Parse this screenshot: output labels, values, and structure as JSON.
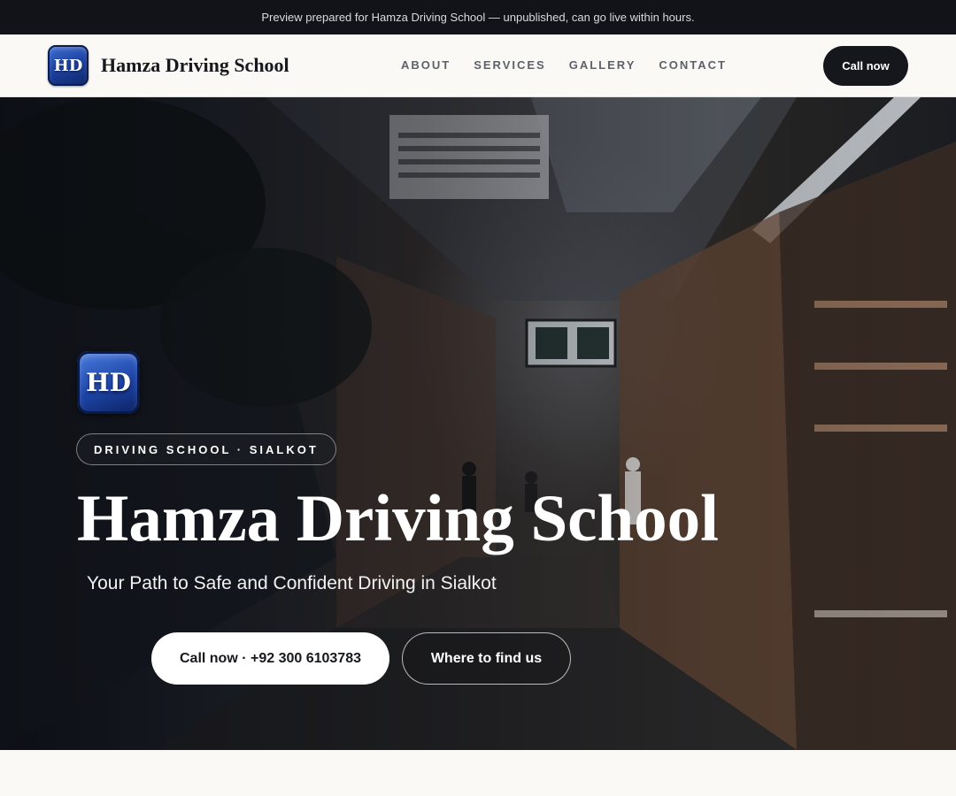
{
  "banner": {
    "text": "Preview prepared for Hamza Driving School — unpublished, can go live within hours."
  },
  "header": {
    "logo_text": "HD",
    "brand_name": "Hamza Driving School",
    "nav": [
      "ABOUT",
      "SERVICES",
      "GALLERY",
      "CONTACT"
    ],
    "cta_label": "Call now"
  },
  "hero": {
    "logo_text": "HD",
    "tag": "DRIVING SCHOOL · SIALKOT",
    "title": "Hamza Driving School",
    "subtitle": "Your Path to Safe and Confident Driving in Sialkot",
    "primary_button": "Call now · +92 300 6103783",
    "secondary_button": "Where to find us",
    "background_image": "market-alley-photo"
  },
  "colors": {
    "banner_bg": "#111318",
    "page_bg": "#faf9f6",
    "dark_button": "#15171c",
    "logo_blue": "#1d44a6"
  }
}
